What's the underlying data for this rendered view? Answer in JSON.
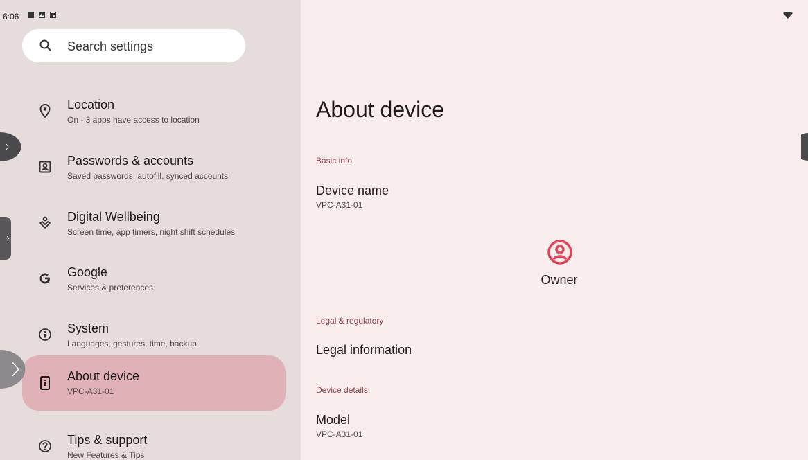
{
  "status_bar": {
    "time": "6:06"
  },
  "search": {
    "placeholder": "Search settings"
  },
  "settings_list": [
    {
      "id": "location",
      "icon": "location-pin-icon",
      "title": "Location",
      "subtitle": "On - 3 apps have access to location"
    },
    {
      "id": "passwords",
      "icon": "account-box-icon",
      "title": "Passwords & accounts",
      "subtitle": "Saved passwords, autofill, synced accounts"
    },
    {
      "id": "wellbeing",
      "icon": "wellbeing-icon",
      "title": "Digital Wellbeing",
      "subtitle": "Screen time, app timers, night shift schedules"
    },
    {
      "id": "google",
      "icon": "google-g-icon",
      "title": "Google",
      "subtitle": "Services & preferences"
    },
    {
      "id": "system",
      "icon": "info-circle-icon",
      "title": "System",
      "subtitle": "Languages, gestures, time, backup"
    },
    {
      "id": "about",
      "icon": "device-info-icon",
      "title": "About device",
      "subtitle": "VPC-A31-01",
      "selected": true
    },
    {
      "id": "tips",
      "icon": "help-circle-icon",
      "title": "Tips & support",
      "subtitle": "New Features & Tips"
    }
  ],
  "detail": {
    "title": "About device",
    "basic_info_header": "Basic info",
    "device_name_label": "Device name",
    "device_name_value": "VPC-A31-01",
    "owner_label": "Owner",
    "legal_header": "Legal & regulatory",
    "legal_info_label": "Legal information",
    "device_details_header": "Device details",
    "model_label": "Model",
    "model_value": "VPC-A31-01"
  },
  "colors": {
    "left_pane": "#e6dcdc",
    "right_pane": "#f8ecec",
    "selected_item": "#e0b2b8",
    "section_header": "#8c3f4a",
    "owner_icon": "#e0445a"
  }
}
